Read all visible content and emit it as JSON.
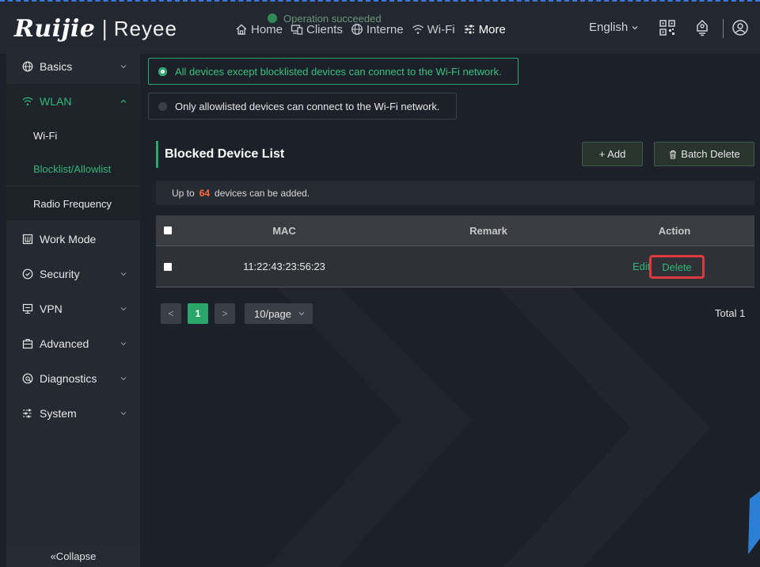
{
  "brand": {
    "logo": "Ruijie",
    "separator": "|",
    "product": "Reyee"
  },
  "toast": {
    "text": "Operation succeeded"
  },
  "nav": [
    {
      "label": "Home",
      "icon": "home-icon"
    },
    {
      "label": "Clients",
      "icon": "clients-icon"
    },
    {
      "label": "Interne",
      "icon": "globe-icon"
    },
    {
      "label": "Wi-Fi",
      "icon": "wifi-icon"
    },
    {
      "label": "More",
      "icon": "more-icon"
    }
  ],
  "header": {
    "language": "English",
    "icons": [
      "qr-code-icon",
      "upgrade-icon",
      "user-icon"
    ]
  },
  "sidebar": {
    "items": [
      {
        "label": "Basics",
        "icon": "globe-icon"
      },
      {
        "label": "WLAN",
        "icon": "wifi-icon"
      },
      {
        "label": "Work Mode",
        "icon": "work-mode-icon"
      },
      {
        "label": "Security",
        "icon": "shield-icon"
      },
      {
        "label": "VPN",
        "icon": "vpn-icon"
      },
      {
        "label": "Advanced",
        "icon": "advanced-icon"
      },
      {
        "label": "Diagnostics",
        "icon": "diagnostics-icon"
      },
      {
        "label": "System",
        "icon": "system-icon"
      }
    ],
    "wlan_sub": [
      "Wi-Fi",
      "Blocklist/Allowlist",
      "Radio Frequency"
    ],
    "collapse": "«Collapse"
  },
  "mode": {
    "blocklist": "All devices except blocklisted devices can connect to the Wi-Fi network.",
    "allowlist": "Only allowlisted devices can connect to the Wi-Fi network.",
    "selected": "blocklist"
  },
  "section": {
    "title": "Blocked Device List",
    "add": "+ Add",
    "batch_delete": "Batch Delete",
    "limit_prefix": "Up to",
    "limit_num": "64",
    "limit_suffix": "devices can be added."
  },
  "table": {
    "headers": {
      "mac": "MAC",
      "remark": "Remark",
      "action": "Action"
    },
    "rows": [
      {
        "mac": "11:22:43:23:56:23",
        "remark": "",
        "edit": "Edit",
        "delete": "Delete"
      }
    ]
  },
  "pagination": {
    "prev": "<",
    "current": "1",
    "next": ">",
    "page_size": "10/page",
    "total": "Total 1"
  },
  "colors": {
    "accent": "#2aa66b",
    "highlight": "#e0393b",
    "warning_num": "#ff6a3d"
  }
}
